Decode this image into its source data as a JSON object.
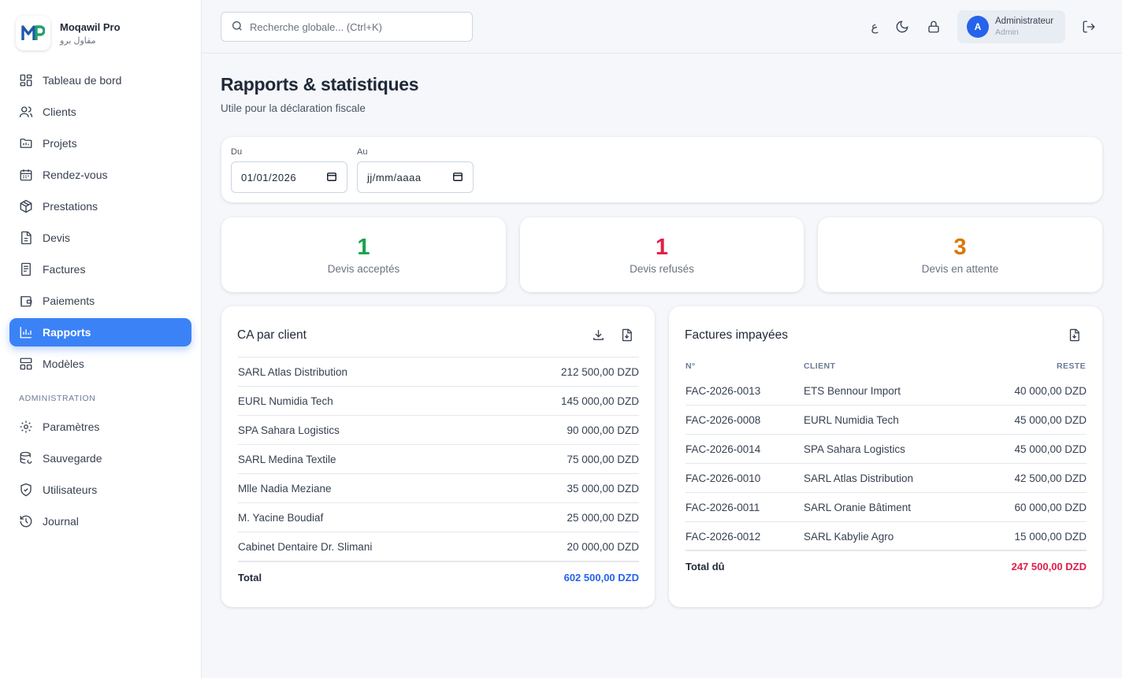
{
  "brand": {
    "name": "Moqawil Pro",
    "sub": "مقاول برو",
    "logo_text": "MP"
  },
  "nav": {
    "items": [
      {
        "label": "Tableau de bord",
        "icon": "dashboard-icon"
      },
      {
        "label": "Clients",
        "icon": "users-icon"
      },
      {
        "label": "Projets",
        "icon": "folder-icon"
      },
      {
        "label": "Rendez-vous",
        "icon": "calendar-icon"
      },
      {
        "label": "Prestations",
        "icon": "package-icon"
      },
      {
        "label": "Devis",
        "icon": "document-icon"
      },
      {
        "label": "Factures",
        "icon": "invoice-icon"
      },
      {
        "label": "Paiements",
        "icon": "wallet-icon"
      },
      {
        "label": "Rapports",
        "icon": "chart-icon",
        "active": true
      },
      {
        "label": "Modèles",
        "icon": "template-icon"
      }
    ],
    "section_label": "ADMINISTRATION",
    "admin_items": [
      {
        "label": "Paramètres",
        "icon": "gear-icon"
      },
      {
        "label": "Sauvegarde",
        "icon": "database-icon"
      },
      {
        "label": "Utilisateurs",
        "icon": "shield-icon"
      },
      {
        "label": "Journal",
        "icon": "history-icon"
      }
    ]
  },
  "topbar": {
    "search_placeholder": "Recherche globale... (Ctrl+K)",
    "lang_label": "ع",
    "user": {
      "initial": "A",
      "name": "Administrateur",
      "role": "Admin"
    }
  },
  "page": {
    "title": "Rapports & statistiques",
    "subtitle": "Utile pour la déclaration fiscale"
  },
  "filters": {
    "from_label": "Du",
    "from_value": "01/01/2026",
    "to_label": "Au",
    "to_value": "jj/mm/aaaa"
  },
  "stats": [
    {
      "value": "1",
      "label": "Devis acceptés",
      "color": "#16a34a"
    },
    {
      "value": "1",
      "label": "Devis refusés",
      "color": "#e11d48"
    },
    {
      "value": "3",
      "label": "Devis en attente",
      "color": "#d97706"
    }
  ],
  "ca_client": {
    "title": "CA par client",
    "rows": [
      {
        "client": "SARL Atlas Distribution",
        "amount": "212 500,00 DZD"
      },
      {
        "client": "EURL Numidia Tech",
        "amount": "145 000,00 DZD"
      },
      {
        "client": "SPA Sahara Logistics",
        "amount": "90 000,00 DZD"
      },
      {
        "client": "SARL Medina Textile",
        "amount": "75 000,00 DZD"
      },
      {
        "client": "Mlle Nadia Meziane",
        "amount": "35 000,00 DZD"
      },
      {
        "client": "M. Yacine Boudiaf",
        "amount": "25 000,00 DZD"
      },
      {
        "client": "Cabinet Dentaire Dr. Slimani",
        "amount": "20 000,00 DZD"
      }
    ],
    "total_label": "Total",
    "total_value": "602 500,00 DZD",
    "total_color": "#2563eb"
  },
  "unpaid": {
    "title": "Factures impayées",
    "headers": {
      "number": "N°",
      "client": "CLIENT",
      "remaining": "RESTE"
    },
    "rows": [
      {
        "number": "FAC-2026-0013",
        "client": "ETS Bennour Import",
        "remaining": "40 000,00 DZD"
      },
      {
        "number": "FAC-2026-0008",
        "client": "EURL Numidia Tech",
        "remaining": "45 000,00 DZD"
      },
      {
        "number": "FAC-2026-0014",
        "client": "SPA Sahara Logistics",
        "remaining": "45 000,00 DZD"
      },
      {
        "number": "FAC-2026-0010",
        "client": "SARL Atlas Distribution",
        "remaining": "42 500,00 DZD"
      },
      {
        "number": "FAC-2026-0011",
        "client": "SARL Oranie Bâtiment",
        "remaining": "60 000,00 DZD"
      },
      {
        "number": "FAC-2026-0012",
        "client": "SARL Kabylie Agro",
        "remaining": "15 000,00 DZD"
      }
    ],
    "total_label": "Total dû",
    "total_value": "247 500,00 DZD",
    "total_color": "#e11d48"
  },
  "colors": {
    "accent": "#3b82f6",
    "sidebar_bg": "#ffffff",
    "page_bg": "#f5f7fb"
  }
}
